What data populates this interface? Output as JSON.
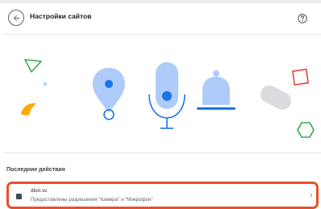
{
  "header": {
    "title": "Настройки сайтов",
    "back_icon": "arrow-left-icon",
    "help_icon": "help-circle-icon"
  },
  "recent": {
    "heading": "Последние действия",
    "items": [
      {
        "site": "dion.vc",
        "description": "Предоставлены разрешения \"Камера\" и \"Микрофон\"",
        "icon": "site-favicon-icon",
        "chevron_icon": "chevron-right-icon"
      }
    ]
  },
  "colors": {
    "accent_blue": "#1a73e8",
    "illustration_blue": "#aecbfa",
    "highlight_border": "#e8502b",
    "triangle_green": "#34a853",
    "square_red": "#ea4335",
    "crescent_yellow": "#f9ab00"
  }
}
